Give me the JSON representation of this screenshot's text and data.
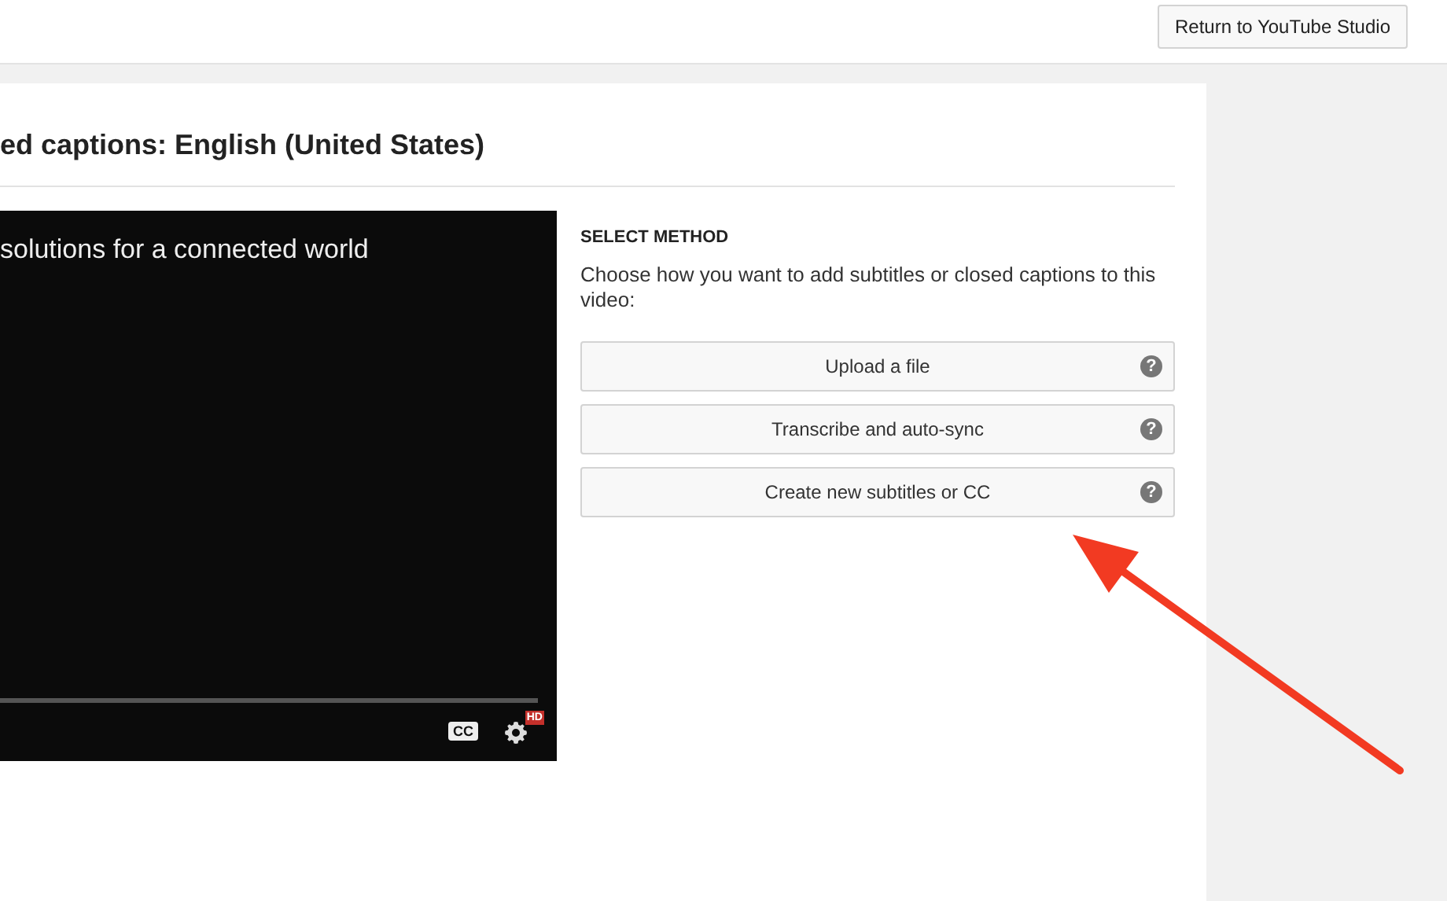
{
  "header": {
    "return_button": "Return to YouTube Studio"
  },
  "title": "ed captions: English (United States)",
  "video": {
    "caption": "solutions for a connected world",
    "cc_label": "CC",
    "hd_badge": "HD"
  },
  "method": {
    "heading": "SELECT METHOD",
    "description": "Choose how you want to add subtitles or closed captions to this video:",
    "options": [
      {
        "label": "Upload a file",
        "help": "?"
      },
      {
        "label": "Transcribe and auto-sync",
        "help": "?"
      },
      {
        "label": "Create new subtitles or CC",
        "help": "?"
      }
    ]
  }
}
